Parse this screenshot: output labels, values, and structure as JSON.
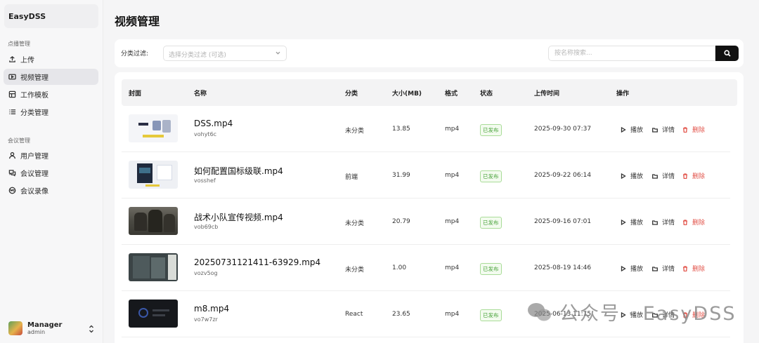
{
  "sidebar": {
    "brand": "EasyDSS",
    "groups": [
      {
        "label": "点播管理",
        "items": [
          {
            "label": "上传",
            "icon": "upload-icon"
          },
          {
            "label": "视频管理",
            "icon": "video-icon",
            "active": true
          },
          {
            "label": "工作模板",
            "icon": "template-icon"
          },
          {
            "label": "分类管理",
            "icon": "list-icon"
          }
        ]
      },
      {
        "label": "会议管理",
        "items": [
          {
            "label": "用户管理",
            "icon": "user-icon"
          },
          {
            "label": "会议管理",
            "icon": "meeting-icon"
          },
          {
            "label": "会议录像",
            "icon": "record-icon"
          }
        ]
      }
    ],
    "user": {
      "name": "Manager",
      "role": "admin"
    }
  },
  "page_title": "视频管理",
  "filter": {
    "label": "分类过滤:",
    "select_placeholder": "选择分类过滤 (可选)",
    "search_placeholder": "按名称搜索..."
  },
  "table": {
    "headers": [
      "封面",
      "名称",
      "分类",
      "大小(MB)",
      "格式",
      "状态",
      "上传时间",
      "操作"
    ],
    "rows": [
      {
        "name": "DSS.mp4",
        "id": "vohyt6c",
        "category": "未分类",
        "size": "13.85",
        "format": "mp4",
        "status": "已发布",
        "uploaded": "2025-09-30 07:37"
      },
      {
        "name": "如何配置国标级联.mp4",
        "id": "vosshef",
        "category": "前端",
        "size": "31.99",
        "format": "mp4",
        "status": "已发布",
        "uploaded": "2025-09-22 06:14"
      },
      {
        "name": "战术小队宣传视频.mp4",
        "id": "vob69cb",
        "category": "未分类",
        "size": "20.79",
        "format": "mp4",
        "status": "已发布",
        "uploaded": "2025-09-16 07:01"
      },
      {
        "name": "20250731121411-63929.mp4",
        "id": "vozv5og",
        "category": "未分类",
        "size": "1.00",
        "format": "mp4",
        "status": "已发布",
        "uploaded": "2025-08-19 14:46"
      },
      {
        "name": "m8.mp4",
        "id": "vo7w7zr",
        "category": "React",
        "size": "23.65",
        "format": "mp4",
        "status": "已发布",
        "uploaded": "2025-06-13 11:15"
      }
    ],
    "actions": {
      "play": "播放",
      "detail": "详情",
      "delete": "删除"
    }
  },
  "watermark": "公众号 · EasyDSS"
}
